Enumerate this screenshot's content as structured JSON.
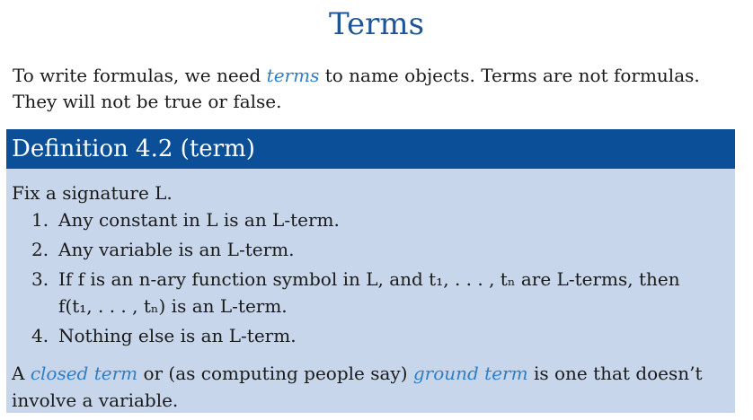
{
  "title": "Terms",
  "intro": {
    "line1_before": "To write formulas, we need ",
    "line1_term": "terms",
    "line1_after": " to name objects. Terms are not formulas.",
    "line2": "They will not be true or false."
  },
  "definition": {
    "header": "Definition 4.2 (term)",
    "lead": "Fix a signature L.",
    "items": [
      {
        "num": "1.",
        "lines": [
          "Any constant in L is an L-term."
        ]
      },
      {
        "num": "2.",
        "lines": [
          "Any variable is an L-term."
        ]
      },
      {
        "num": "3.",
        "lines": [
          "If f is an n-ary function symbol in L, and t₁, . . . , tₙ are L-terms, then",
          "f(t₁, . . . , tₙ) is an L-term."
        ]
      },
      {
        "num": "4.",
        "lines": [
          "Nothing else is an L-term."
        ]
      }
    ],
    "footer": {
      "a": "A ",
      "closed_term": "closed term",
      "b": " or (as computing people say) ",
      "ground_term": "ground term",
      "c": " is one that doesn’t",
      "line2": "involve a variable."
    }
  },
  "colors": {
    "title": "#1f5496",
    "emphasis": "#2f7fc8",
    "header_bg": "#0b4f98",
    "box_bg": "#c7d6ea"
  }
}
